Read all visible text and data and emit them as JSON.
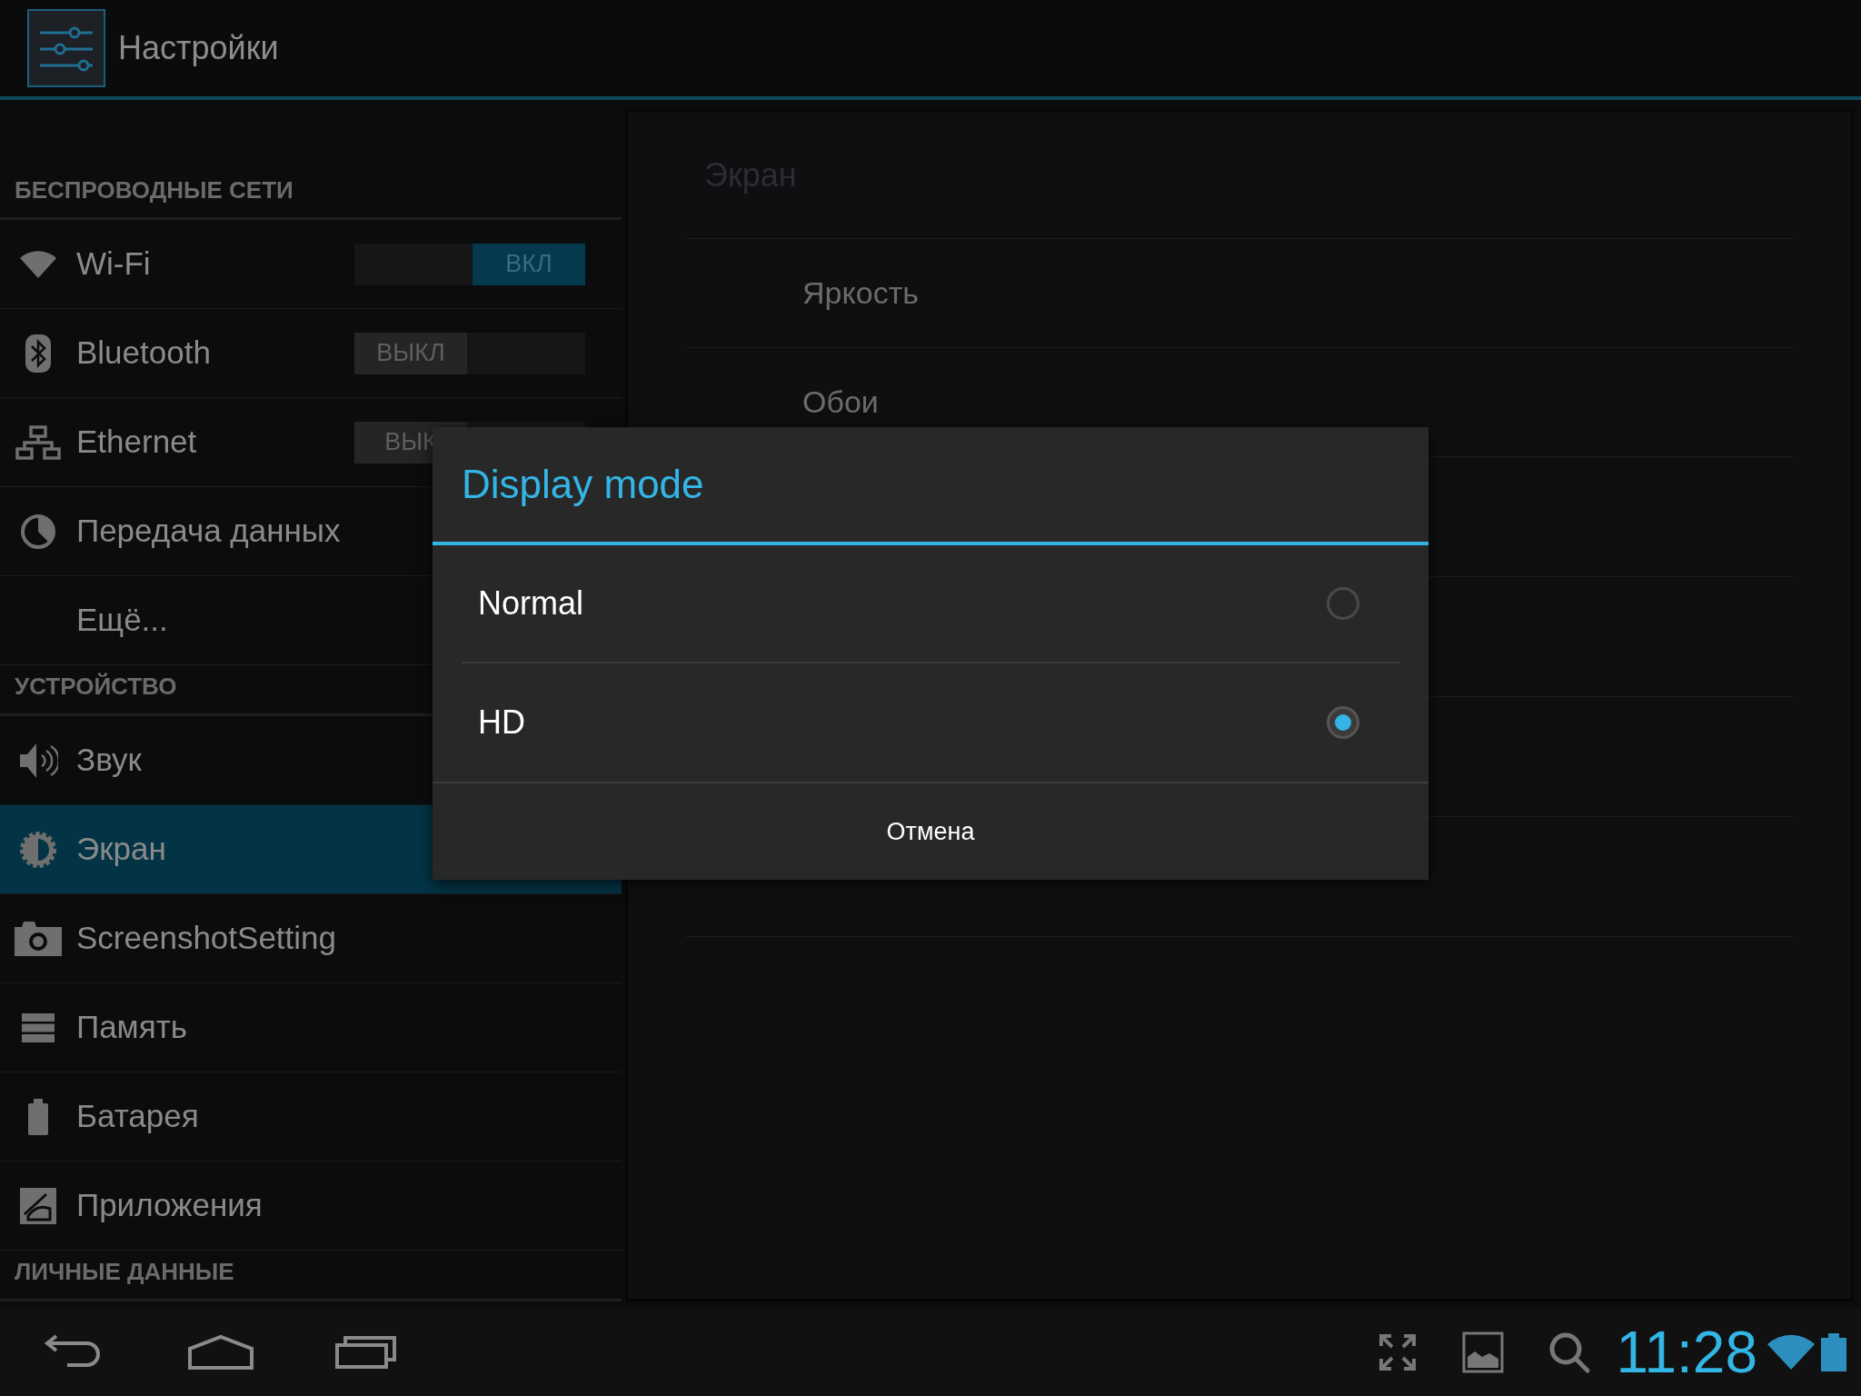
{
  "header": {
    "title": "Настройки"
  },
  "sidebar": {
    "sections": [
      {
        "heading": "БЕСПРОВОДНЫЕ СЕТИ",
        "items": [
          {
            "label": "Wi-Fi",
            "selected": false,
            "kind": "toggle",
            "toggle": {
              "on": true,
              "label": "ВКЛ"
            }
          },
          {
            "label": "Bluetooth",
            "selected": false,
            "kind": "toggle",
            "toggle": {
              "on": false,
              "label": "ВЫКЛ"
            }
          },
          {
            "label": "Ethernet",
            "selected": false,
            "kind": "toggle",
            "toggle": {
              "on": false,
              "label": "ВЫК"
            }
          },
          {
            "label": "Передача данных",
            "selected": false,
            "kind": "plain"
          },
          {
            "label": "Ещё...",
            "selected": false,
            "kind": "plain"
          }
        ]
      },
      {
        "heading": "УСТРОЙСТВО",
        "items": [
          {
            "label": "Звук",
            "selected": false,
            "kind": "plain"
          },
          {
            "label": "Экран",
            "selected": true,
            "kind": "plain"
          },
          {
            "label": "ScreenshotSetting",
            "selected": false,
            "kind": "plain"
          },
          {
            "label": "Память",
            "selected": false,
            "kind": "plain"
          },
          {
            "label": "Батарея",
            "selected": false,
            "kind": "plain"
          },
          {
            "label": "Приложения",
            "selected": false,
            "kind": "plain"
          }
        ]
      },
      {
        "heading": "ЛИЧНЫЕ ДАННЫЕ"
      }
    ]
  },
  "detail": {
    "title": "Экран",
    "items": [
      "Яркость",
      "Обои"
    ]
  },
  "dialog": {
    "title": "Display mode",
    "options": [
      {
        "label": "Normal",
        "selected": false
      },
      {
        "label": "HD",
        "selected": true
      }
    ],
    "cancel": "Отмена"
  },
  "nav_bar": {
    "time": "11:28"
  }
}
